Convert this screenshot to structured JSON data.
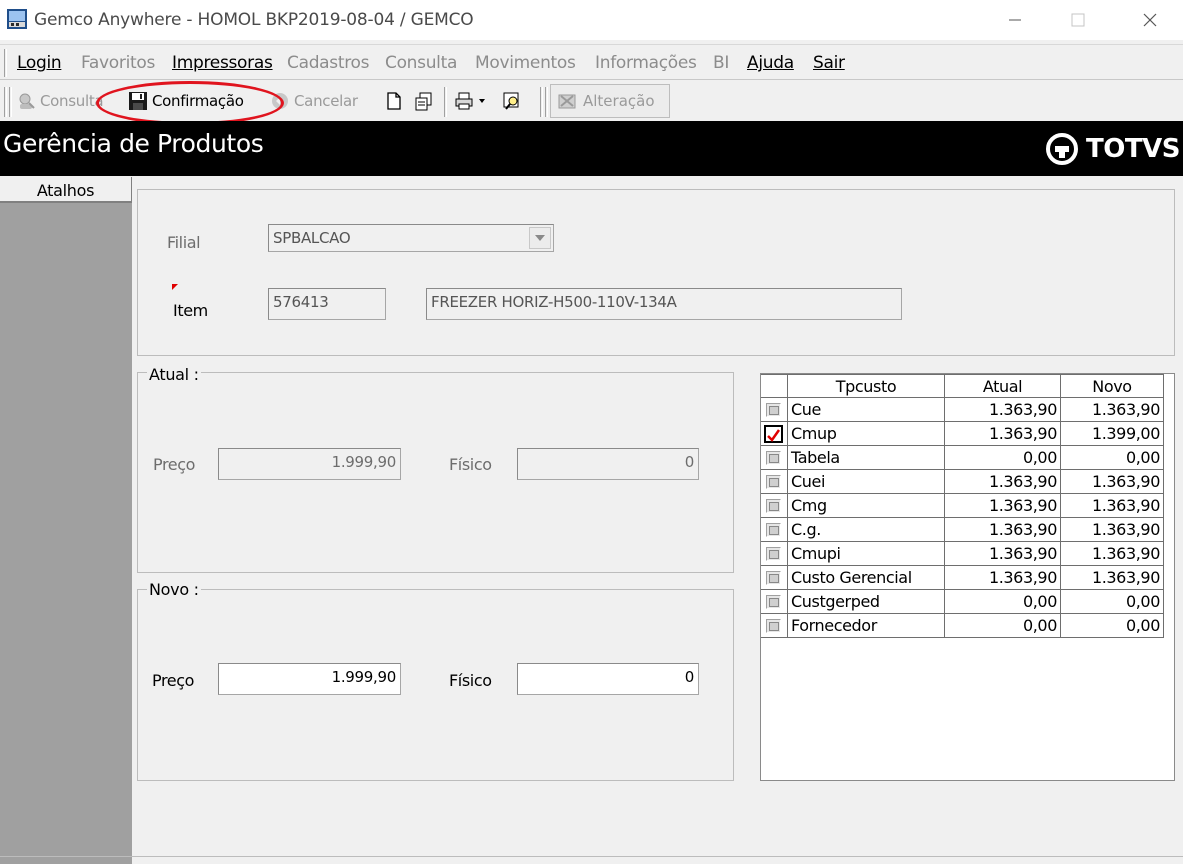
{
  "window": {
    "title": "Gemco Anywhere - HOMOL BKP2019-08-04 / GEMCO"
  },
  "menu": {
    "items": [
      {
        "label": "Login",
        "enabled": true
      },
      {
        "label": "Favoritos",
        "enabled": false
      },
      {
        "label": "Impressoras",
        "enabled": true
      },
      {
        "label": "Cadastros",
        "enabled": false
      },
      {
        "label": "Consulta",
        "enabled": false
      },
      {
        "label": "Movimentos",
        "enabled": false
      },
      {
        "label": "Informações",
        "enabled": false
      },
      {
        "label": "BI",
        "enabled": false
      },
      {
        "label": "Ajuda",
        "enabled": true
      },
      {
        "label": "Sair",
        "enabled": true
      }
    ]
  },
  "toolbar": {
    "consulta": "Consulta",
    "confirmacao": "Confirmação",
    "cancelar": "Cancelar",
    "alteracao": "Alteração",
    "highlight_color": "#e0141e"
  },
  "header": {
    "title": "Gerência de Produtos",
    "brand": "TOTVS"
  },
  "sidebar": {
    "atalhos": "Atalhos"
  },
  "form": {
    "filial_label": "Filial",
    "filial_value": "SPBALCAO",
    "item_label": "Item",
    "item_code": "576413",
    "item_description": "FREEZER HORIZ-H500-110V-134A"
  },
  "atual": {
    "legend": "Atual :",
    "preco_label": "Preço",
    "preco_value": "1.999,90",
    "fisico_label": "Físico",
    "fisico_value": "0"
  },
  "novo": {
    "legend": "Novo :",
    "preco_label": "Preço",
    "preco_value": "1.999,90",
    "fisico_label": "Físico",
    "fisico_value": "0"
  },
  "grid": {
    "headers": [
      "Tpcusto",
      "Atual",
      "Novo"
    ],
    "rows": [
      {
        "tp": "Cue",
        "atual": "1.363,90",
        "novo": "1.363,90",
        "checked": false
      },
      {
        "tp": "Cmup",
        "atual": "1.363,90",
        "novo": "1.399,00",
        "checked": true
      },
      {
        "tp": "Tabela",
        "atual": "0,00",
        "novo": "0,00",
        "checked": false
      },
      {
        "tp": "Cuei",
        "atual": "1.363,90",
        "novo": "1.363,90",
        "checked": false
      },
      {
        "tp": "Cmg",
        "atual": "1.363,90",
        "novo": "1.363,90",
        "checked": false
      },
      {
        "tp": "C.g.",
        "atual": "1.363,90",
        "novo": "1.363,90",
        "checked": false
      },
      {
        "tp": "Cmupi",
        "atual": "1.363,90",
        "novo": "1.363,90",
        "checked": false
      },
      {
        "tp": "Custo Gerencial",
        "atual": "1.363,90",
        "novo": "1.363,90",
        "checked": false
      },
      {
        "tp": "Custgerped",
        "atual": "0,00",
        "novo": "0,00",
        "checked": false
      },
      {
        "tp": "Fornecedor",
        "atual": "0,00",
        "novo": "0,00",
        "checked": false
      }
    ]
  }
}
